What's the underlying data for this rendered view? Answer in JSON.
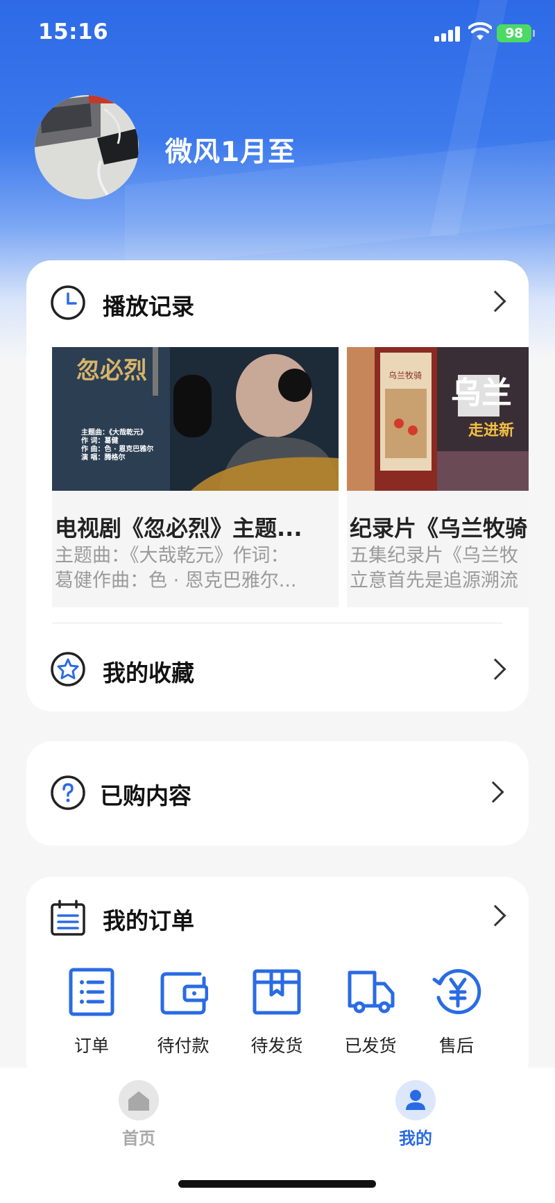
{
  "status_bar": {
    "time": "15:16",
    "battery": "98"
  },
  "profile": {
    "username": "微风1月至"
  },
  "history": {
    "title": "播放记录",
    "items": [
      {
        "title": "电视剧《忽必烈》主题...",
        "desc_line1": "主题曲：《大哉乾元》作词：",
        "desc_line2": "葛健作曲：色 · 恩克巴雅尔...",
        "poster_text": [
          "主题曲：《大哉乾元》",
          "作    词：葛健",
          "作    曲：色 · 恩克巴雅尔",
          "演    唱：腾格尔"
        ]
      },
      {
        "title": "纪录片《乌兰牧骑",
        "desc_line1": "五集纪录片《乌兰牧",
        "desc_line2": "立意首先是追源溯流",
        "poster_text": [
          "乌兰牧骑",
          "乌兰",
          "走进新"
        ]
      }
    ]
  },
  "favorites": {
    "title": "我的收藏"
  },
  "purchased": {
    "title": "已购内容"
  },
  "orders": {
    "title": "我的订单",
    "items": [
      {
        "label": "订单",
        "icon": "order-list-icon"
      },
      {
        "label": "待付款",
        "icon": "wallet-icon"
      },
      {
        "label": "待发货",
        "icon": "package-icon"
      },
      {
        "label": "已发货",
        "icon": "truck-icon"
      },
      {
        "label": "售后",
        "icon": "refund-yen-icon"
      }
    ]
  },
  "tabbar": {
    "tabs": [
      {
        "label": "首页",
        "active": false
      },
      {
        "label": "我的",
        "active": true
      }
    ]
  },
  "colors": {
    "accent": "#2a6be4",
    "inactive": "#a8a8a8",
    "battery": "#4cd964"
  }
}
